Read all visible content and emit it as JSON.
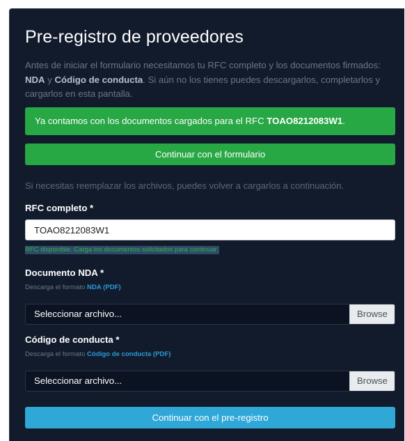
{
  "title": "Pre-registro de proveedores",
  "intro": {
    "part1": "Antes de iniciar el formulario necesitamos tu RFC completo y los documentos firmados: ",
    "nda": "NDA",
    "and": " y ",
    "code": "Código de conducta",
    "part2": ". Si aún no los tienes puedes descargarlos, completarlos y cargarlos en esta pantalla."
  },
  "alert": {
    "text": "Ya contamos con los documentos cargados para el RFC ",
    "rfc": "TOAO8212083W1",
    "end": "."
  },
  "continue_form_button": "Continuar con el formulario",
  "replace_note": "Si necesitas reemplazar los archivos, puedes volver a cargarlos a continuación.",
  "rfc_field": {
    "label": "RFC completo *",
    "value": "TOAO8212083W1",
    "status": "RFC disponible. Carga los documentos solicitados para continuar."
  },
  "nda_field": {
    "label": "Documento NDA *",
    "hint": "Descarga el formato ",
    "link": "NDA (PDF)",
    "placeholder": "Seleccionar archivo...",
    "browse": "Browse"
  },
  "code_field": {
    "label": "Código de conducta *",
    "hint": "Descarga el formato ",
    "link": "Código de conducta (PDF)",
    "placeholder": "Seleccionar archivo...",
    "browse": "Browse"
  },
  "submit_button": "Continuar con el pre-registro",
  "colors": {
    "background": "#121b2c",
    "success": "#28a745",
    "primary": "#2fa8d8",
    "link": "#2a9bd8"
  }
}
